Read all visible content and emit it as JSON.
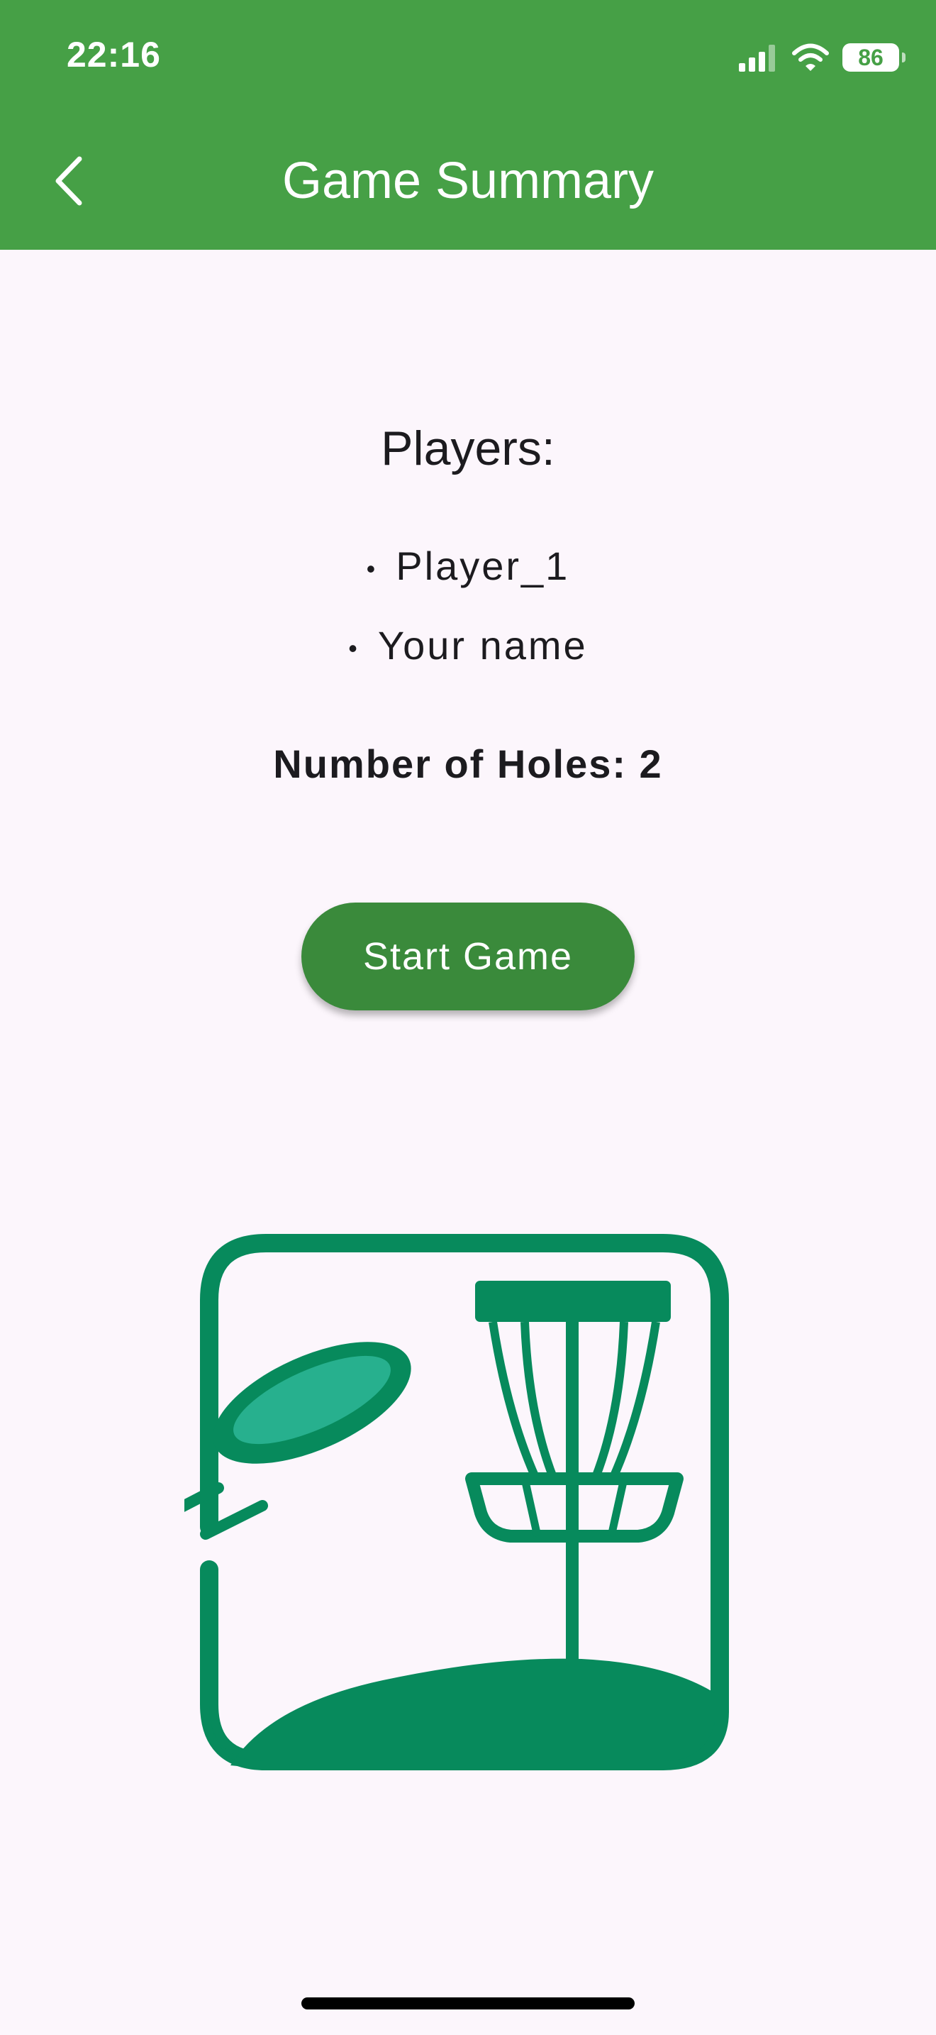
{
  "status_bar": {
    "time": "22:16",
    "battery_level": "86"
  },
  "header": {
    "title": "Game Summary"
  },
  "summary": {
    "players_heading": "Players:",
    "players": [
      "Player_1",
      "Your name"
    ],
    "bullet": "•",
    "holes_text": "Number of Holes: 2"
  },
  "actions": {
    "start_label": "Start Game"
  },
  "icons": {
    "back": "chevron-left-icon",
    "signal": "signal-bars-icon",
    "wifi": "wifi-icon",
    "battery": "battery-icon",
    "logo": "disc-golf-basket-icon"
  },
  "colors": {
    "app_bar": "#46a046",
    "button": "#3a8a3b",
    "logo": "#078a5c",
    "disc_inner": "#27b08e",
    "background": "#fcf6fc"
  }
}
